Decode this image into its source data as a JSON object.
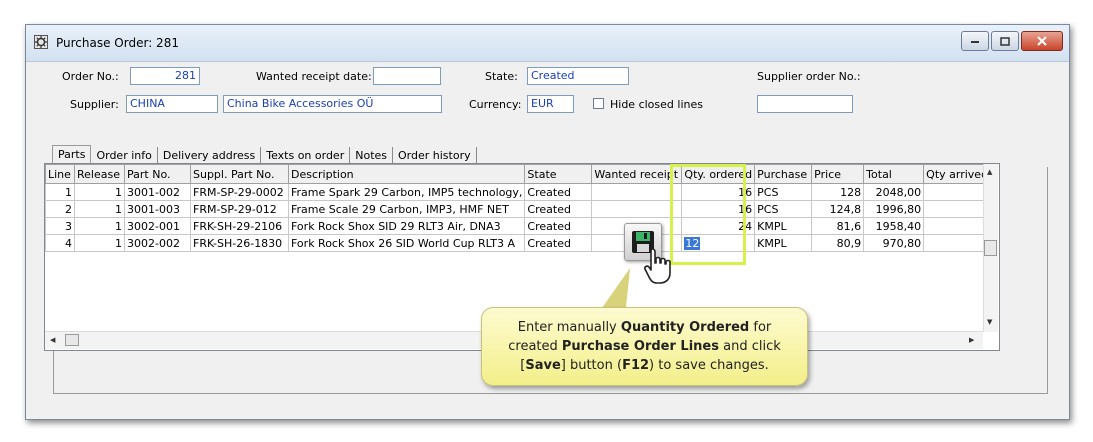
{
  "window": {
    "title": "Purchase Order: 281"
  },
  "header": {
    "order_no_label": "Order No.:",
    "order_no_value": "281",
    "wanted_receipt_label": "Wanted receipt date:",
    "wanted_receipt_value": "",
    "state_label": "State:",
    "state_value": "Created",
    "supplier_order_label": "Supplier order No.:",
    "supplier_order_value": "",
    "supplier_label": "Supplier:",
    "supplier_code": "CHINA",
    "supplier_name": "China Bike Accessories OÜ",
    "currency_label": "Currency:",
    "currency_value": "EUR",
    "hide_closed_label": "Hide closed lines"
  },
  "tabs": [
    "Parts",
    "Order info",
    "Delivery address",
    "Texts on order",
    "Notes",
    "Order history"
  ],
  "grid": {
    "columns": [
      "Line",
      "Release",
      "Part No.",
      "Suppl. Part No.",
      "Description",
      "State",
      "Wanted receipt",
      "Qty. ordered",
      "Purchase",
      "Price",
      "Total",
      "Qty arrived"
    ],
    "rows": [
      {
        "line": "1",
        "release": "1",
        "part_no": "3001-002",
        "suppl_part": "FRM-SP-29-0002",
        "description": "Frame Spark 29 Carbon, IMP5 technology,",
        "state": "Created",
        "wanted": "",
        "qty": "16",
        "unit": "PCS",
        "price": "128",
        "total": "2048,00",
        "arrived": ""
      },
      {
        "line": "2",
        "release": "1",
        "part_no": "3001-003",
        "suppl_part": "FRM-SP-29-012",
        "description": "Frame Scale 29 Carbon, IMP3, HMF NET",
        "state": "Created",
        "wanted": "",
        "qty": "16",
        "unit": "PCS",
        "price": "124,8",
        "total": "1996,80",
        "arrived": ""
      },
      {
        "line": "3",
        "release": "1",
        "part_no": "3002-001",
        "suppl_part": "FRK-SH-29-2106",
        "description": "Fork Rock Shox SID 29 RLT3 Air, DNA3",
        "state": "Created",
        "wanted": "",
        "qty": "24",
        "unit": "KMPL",
        "price": "81,6",
        "total": "1958,40",
        "arrived": ""
      },
      {
        "line": "4",
        "release": "1",
        "part_no": "3002-002",
        "suppl_part": "FRK-SH-26-1830",
        "description": "Fork Rock Shox 26 SID World Cup RLT3 A",
        "state": "Created",
        "wanted": "",
        "qty": "12",
        "unit": "KMPL",
        "price": "80,9",
        "total": "970,80",
        "arrived": ""
      }
    ]
  },
  "callout": {
    "t1": "Enter manually ",
    "b1": "Quantity Ordered",
    "t2": " for",
    "t3": "created ",
    "b2": "Purchase Order Lines",
    "t4": " and click",
    "t5": "[",
    "b3": "Save",
    "t6": "] button (",
    "b4": "F12",
    "t7": ") to save changes."
  },
  "colors": {
    "link_blue": "#1a3fb5",
    "qty_green": "#2c8a2c",
    "highlight": "#d8f04a",
    "callout_bg": "#f6f2a0"
  }
}
